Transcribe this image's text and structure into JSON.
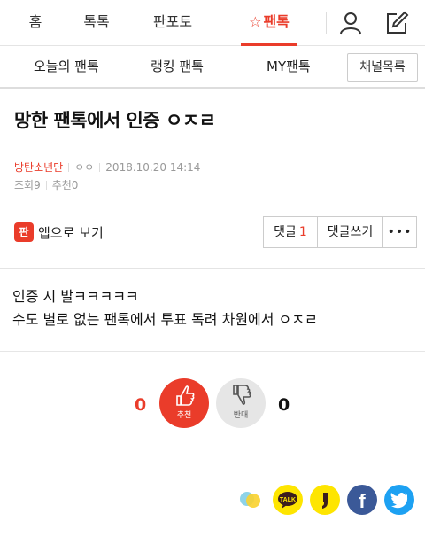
{
  "top_nav": {
    "tabs": [
      {
        "label": "홈"
      },
      {
        "label": "톡톡"
      },
      {
        "label": "판포토"
      },
      {
        "label": "팬톡",
        "active": true
      }
    ],
    "star_icon": "☆",
    "profile_icon": "profile-icon",
    "write_icon": "edit-icon",
    "accent_color": "#ea3c2a"
  },
  "sub_nav": {
    "items": [
      {
        "label": "오늘의 팬톡"
      },
      {
        "label": "랭킹 팬톡"
      },
      {
        "label": "MY팬톡"
      }
    ],
    "channel_button": "채널목록"
  },
  "post": {
    "title": "망한 팬톡에서 인증 ㅇㅈㄹ",
    "author": "방탄소년단",
    "nickname": "ㅇㅇ",
    "date": "2018.10.20 14:14",
    "views": "조회9",
    "recommends": "추천0",
    "app_view_icon": "판",
    "app_view_label": "앱으로 보기",
    "comment_label": "댓글",
    "comment_count": "1",
    "write_comment_label": "댓글쓰기",
    "more_label": "•••",
    "body_lines": [
      "인증 시 발ㅋㅋㅋㅋㅋ",
      "수도 별로 없는 팬톡에서 투표 독려 차원에서 ㅇㅈㄹ"
    ]
  },
  "vote": {
    "up_count": "0",
    "up_label": "추천",
    "down_label": "반대",
    "down_count": "0"
  },
  "share": {
    "icons": [
      "kakaostory-icon",
      "kakaotalk-icon",
      "kakaopage-icon",
      "facebook-icon",
      "twitter-icon"
    ],
    "talk_label": "TALK",
    "facebook_glyph": "f"
  }
}
